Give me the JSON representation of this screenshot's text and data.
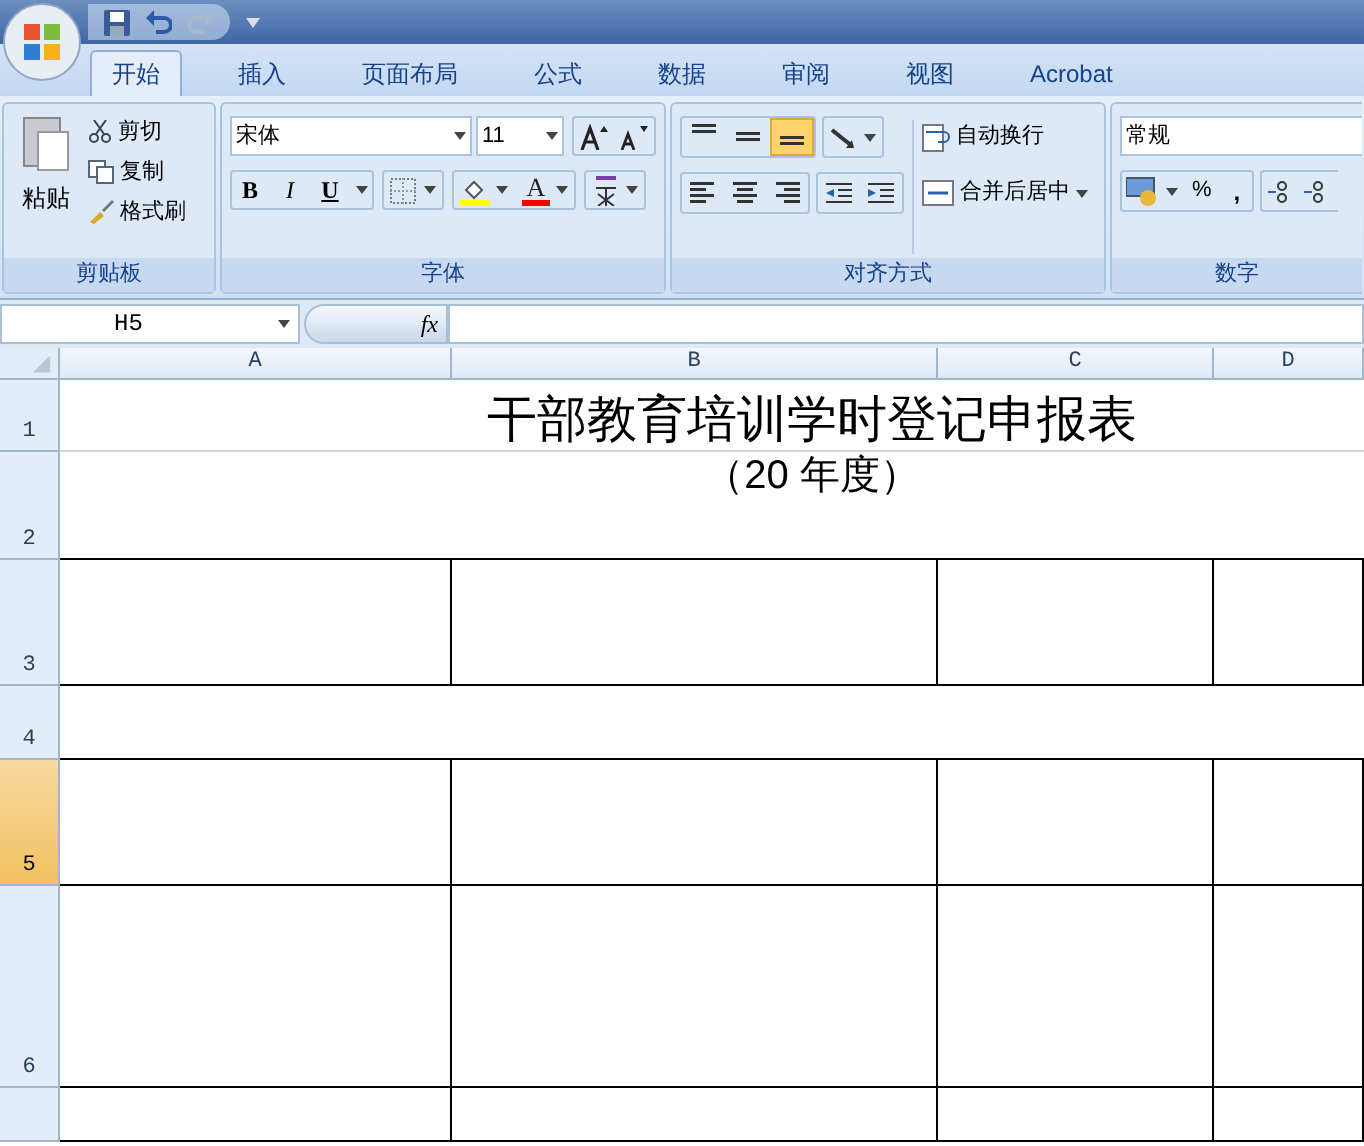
{
  "tabs": [
    {
      "label": "开始",
      "selected": true
    },
    {
      "label": "插入",
      "selected": false
    },
    {
      "label": "页面布局",
      "selected": false
    },
    {
      "label": "公式",
      "selected": false
    },
    {
      "label": "数据",
      "selected": false
    },
    {
      "label": "审阅",
      "selected": false
    },
    {
      "label": "视图",
      "selected": false
    },
    {
      "label": "Acrobat",
      "selected": false
    }
  ],
  "clipboard": {
    "paste": "粘贴",
    "cut": "剪切",
    "copy": "复制",
    "format_painter": "格式刷",
    "label": "剪贴板"
  },
  "font": {
    "font_name": "宋体",
    "font_size": "11",
    "bold": "B",
    "italic": "I",
    "underline": "U",
    "font_color": "A",
    "label": "字体"
  },
  "alignment": {
    "vertical": [
      {
        "selected": false
      },
      {
        "selected": false
      },
      {
        "selected": true
      }
    ],
    "wrap_text": "自动换行",
    "merge_center": "合并后居中",
    "label": "对齐方式"
  },
  "number": {
    "format": "常规",
    "percent": "%",
    "comma": ",",
    "label": "数字"
  },
  "formula_bar": {
    "name_box": "H5",
    "fx": "fx"
  },
  "columns": [
    {
      "label": "A"
    },
    {
      "label": "B"
    },
    {
      "label": "C"
    },
    {
      "label": "D"
    }
  ],
  "rows": [
    {
      "number": "1",
      "selected": false,
      "kind": "title",
      "text": "干部教育培训学时登记申报表"
    },
    {
      "number": "2",
      "selected": false,
      "kind": "subtitle",
      "text": "（20  年度）"
    },
    {
      "number": "3",
      "selected": false,
      "kind": "table"
    },
    {
      "number": "4",
      "selected": false,
      "kind": "blank"
    },
    {
      "number": "5",
      "selected": true,
      "kind": "table"
    },
    {
      "number": "6",
      "selected": false,
      "kind": "table"
    },
    {
      "selected": false,
      "kind": "table"
    }
  ]
}
